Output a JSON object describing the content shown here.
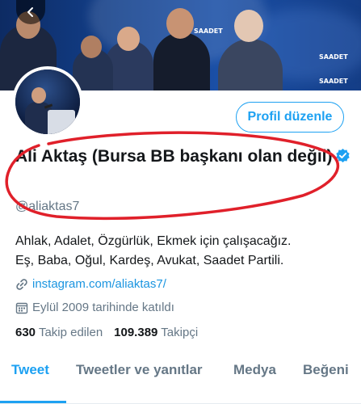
{
  "profile": {
    "name": "Ali Aktaş (Bursa BB başkanı olan değil)",
    "handle": "@aliaktas7",
    "bio_line1": "Ahlak, Adalet, Özgürlük, Ekmek için çalışacağız.",
    "bio_line2": "Eş, Baba, Oğul, Kardeş, Avukat, Saadet Partili.",
    "link": "instagram.com/aliaktas7/",
    "joined": "Eylül 2009 tarihinde katıldı",
    "following_count": "630",
    "following_label": "Takip edilen",
    "followers_count": "109.389",
    "followers_label": "Takipçi",
    "verified": true
  },
  "buttons": {
    "edit_profile": "Profil düzenle"
  },
  "banner": {
    "sign_text": "SAADET"
  },
  "tabs": [
    {
      "label": "Tweet",
      "active": true
    },
    {
      "label": "Tweetler ve yanıtlar",
      "active": false
    },
    {
      "label": "Medya",
      "active": false
    },
    {
      "label": "Beğeni",
      "active": false
    }
  ],
  "colors": {
    "accent": "#1da1f2",
    "annotation": "#e0202a",
    "secondary_text": "#657786"
  },
  "icons": {
    "back": "arrow-left-icon",
    "verified": "verified-badge-icon",
    "link": "link-icon",
    "calendar": "calendar-icon"
  }
}
